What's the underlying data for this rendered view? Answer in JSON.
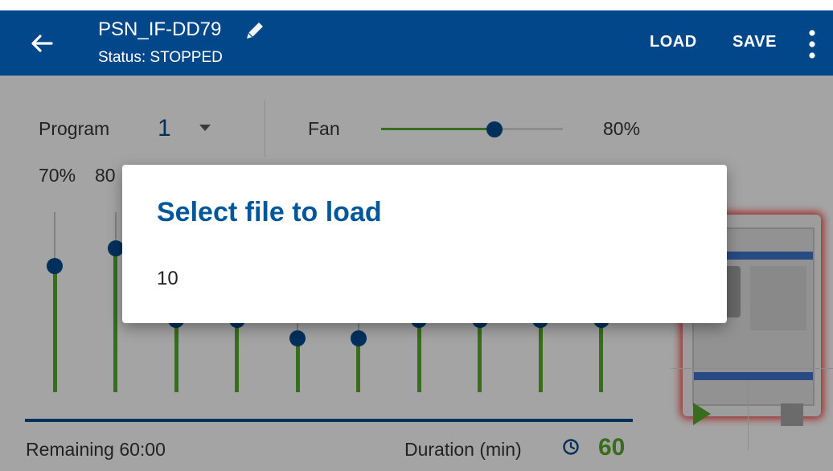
{
  "appbar": {
    "title": "PSN_IF-DD79",
    "status": "Status: STOPPED",
    "load_label": "LOAD",
    "save_label": "SAVE"
  },
  "program": {
    "label": "Program",
    "value": "1"
  },
  "fan": {
    "label": "Fan",
    "value_text": "80%",
    "level": 0.8
  },
  "channel_percents": [
    "70%",
    "80"
  ],
  "faders": [
    0.7,
    0.8,
    0.4,
    0.4,
    0.3,
    0.3,
    0.4,
    0.4,
    0.4,
    0.4
  ],
  "progress": 1.0,
  "footer": {
    "remaining": "Remaining 60:00",
    "duration_label": "Duration (min)",
    "duration_value": "60"
  },
  "dialog": {
    "title": "Select file to load",
    "items": [
      "10"
    ]
  },
  "colors": {
    "primary": "#02478a",
    "accent_green": "#52a12a",
    "dialog_title": "#02579b",
    "alert_red": "#e53935"
  },
  "icons": [
    "back-arrow-icon",
    "pencil-icon",
    "more-vert-icon",
    "dropdown-caret-icon",
    "clock-icon",
    "play-icon",
    "stop-icon"
  ]
}
